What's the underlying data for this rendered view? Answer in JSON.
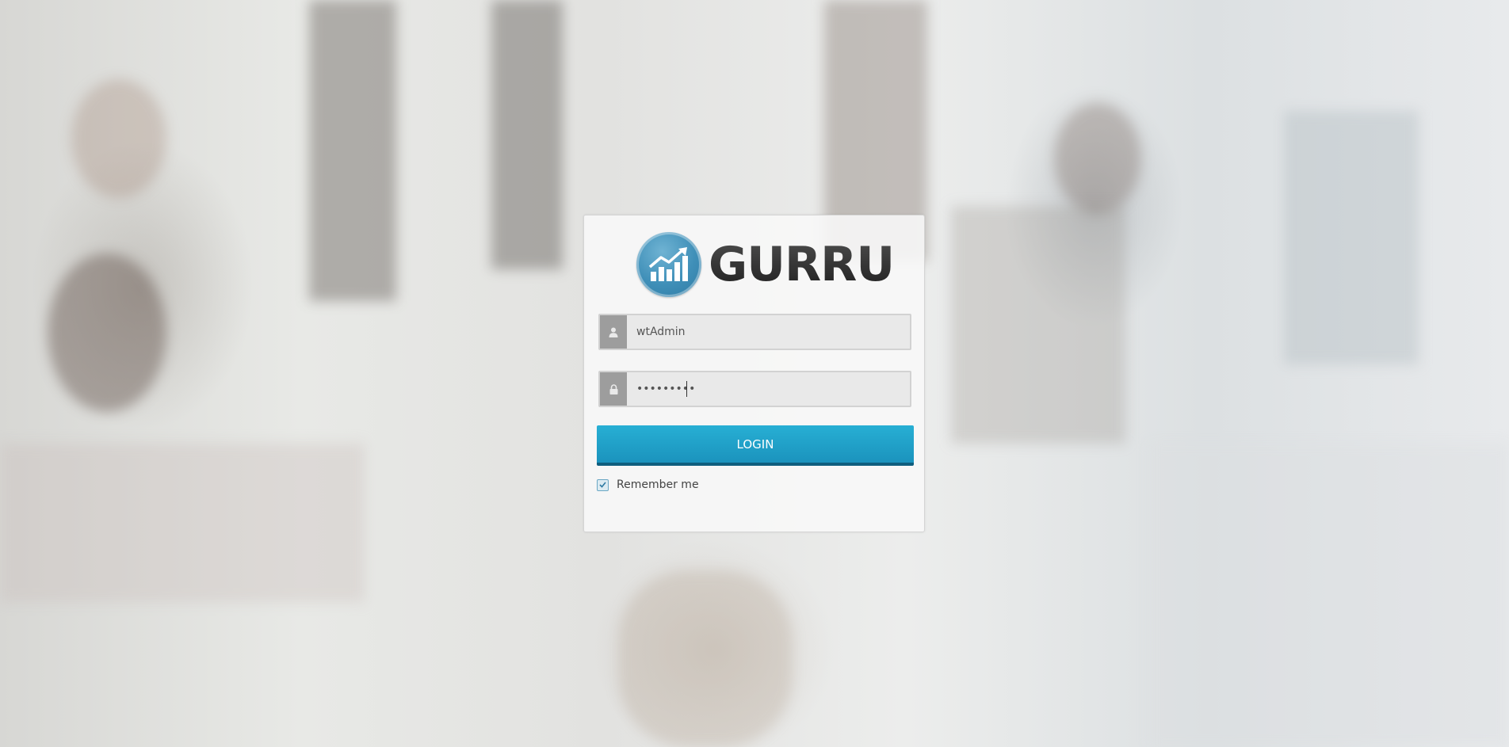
{
  "brand": {
    "name": "GURRU",
    "logo_icon": "chart-arrow-up-icon",
    "accent": "#3f8fb8"
  },
  "login_form": {
    "username": {
      "icon": "user-icon",
      "value": "wtAdmin"
    },
    "password": {
      "icon": "lock-icon",
      "value": "•••••••••"
    },
    "submit_label": "LOGIN",
    "submit_color": "#1b93bd",
    "remember": {
      "label": "Remember me",
      "checked": true
    }
  }
}
